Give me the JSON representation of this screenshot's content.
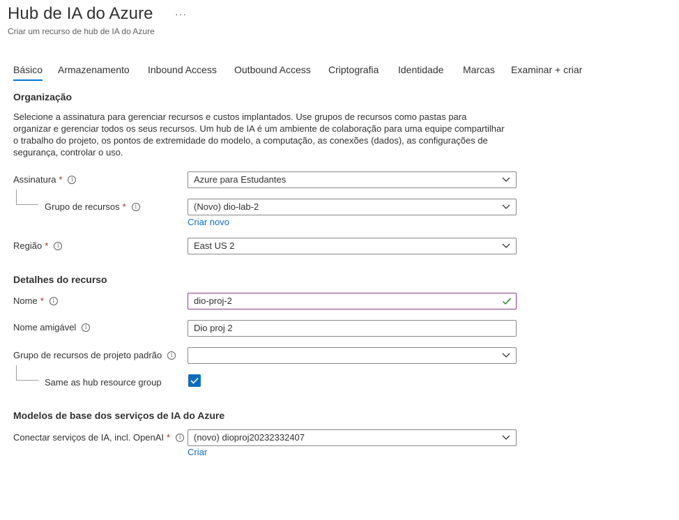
{
  "header": {
    "title": "Hub de IA do Azure",
    "ellipsis": "···",
    "subtitle": "Criar um recurso de hub de IA do Azure"
  },
  "tabs": [
    {
      "label": "Básico",
      "active": true
    },
    {
      "label": "Armazenamento"
    },
    {
      "label": "Inbound Access"
    },
    {
      "label": "Outbound Access"
    },
    {
      "label": "Criptografia"
    },
    {
      "label": "Identidade"
    },
    {
      "label": "Marcas"
    },
    {
      "label": "Examinar + criar"
    }
  ],
  "organizacao": {
    "title": "Organização",
    "description": "Selecione a assinatura para gerenciar recursos e custos implantados. Use grupos de recursos como pastas para organizar e gerenciar todos os seus recursos. Um hub de IA é um ambiente de colaboração para uma equipe compartilhar o trabalho do projeto, os pontos de extremidade do modelo, a computação, as conexões (dados), as configurações de segurança, controlar o uso.",
    "assinatura": {
      "label": "Assinatura",
      "required": "*",
      "value": "Azure para Estudantes"
    },
    "grupo_recursos": {
      "label": "Grupo de recursos",
      "required": "*",
      "value": "(Novo) dio-lab-2",
      "link": "Criar novo"
    },
    "regiao": {
      "label": "Região",
      "required": "*",
      "value": "East US 2"
    }
  },
  "detalhes": {
    "title": "Detalhes do recurso",
    "nome": {
      "label": "Nome",
      "required": "*",
      "value": "dio-proj-2"
    },
    "nome_amigavel": {
      "label": "Nome amigável",
      "value": "Dio proj 2"
    },
    "grupo_projeto": {
      "label": "Grupo de recursos de projeto padrão",
      "value": ""
    },
    "same_as_hub": {
      "label": "Same as hub resource group",
      "checked": true
    }
  },
  "modelos": {
    "title": "Modelos de base dos serviços de IA do Azure",
    "conectar": {
      "label": "Conectar serviços de IA, incl. OpenAI",
      "required": "*",
      "value": "(novo) dioproj20232332407",
      "link": "Criar"
    }
  },
  "colors": {
    "accent": "#0078d4",
    "link": "#0f6cbd",
    "required": "#a4262c",
    "valid_check": "#107c10"
  },
  "icons": {
    "info": "info-icon",
    "dropdown": "chevron-down-icon",
    "valid": "checkmark-icon",
    "checkbox": "checkbox-checked-icon"
  }
}
